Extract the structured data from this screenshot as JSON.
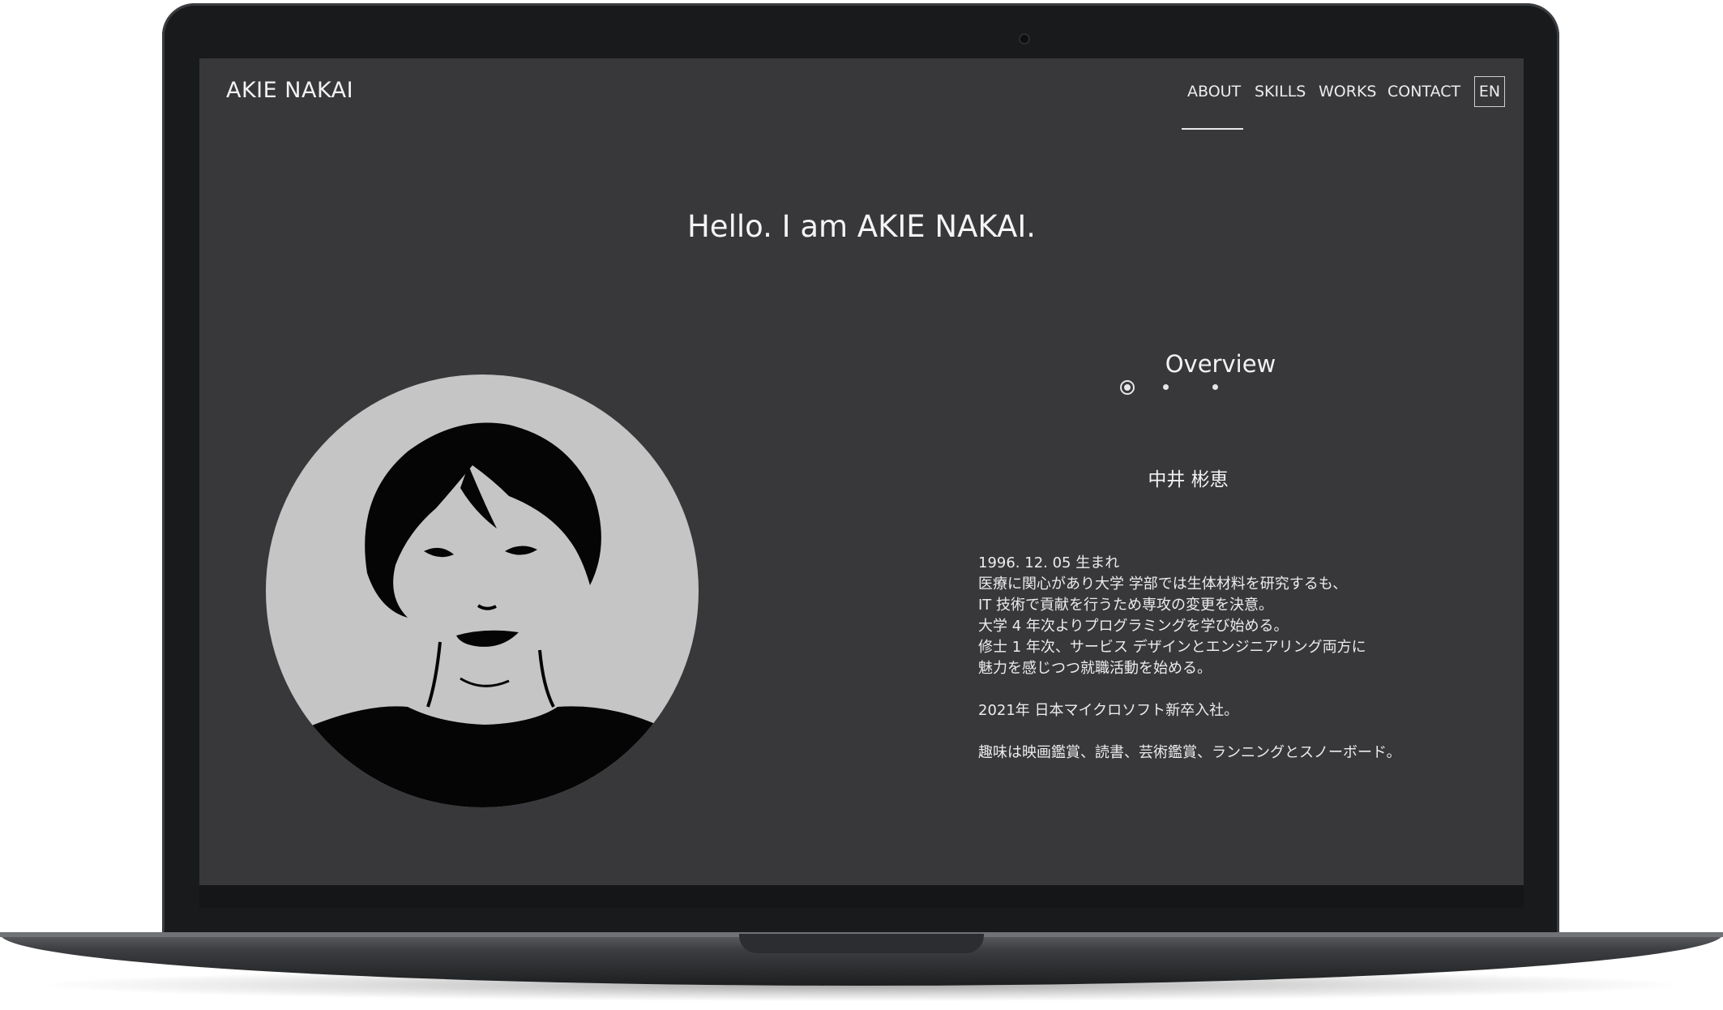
{
  "site": {
    "brand": "AKIE NAKAI",
    "nav": {
      "about": "ABOUT",
      "skills": "SKILLS",
      "works": "WORKS",
      "contact": "CONTACT",
      "lang": "EN",
      "active": "about"
    },
    "hero_title": "Hello. I am AKIE NAKAI.",
    "overview": {
      "title": "Overview",
      "dots": 3,
      "active_dot": 1
    },
    "name": "中井 彬恵",
    "bio": {
      "line1": "1996. 12. 05 生まれ",
      "line2": "医療に関心があり大学 学部では生体材料を研究するも、",
      "line3": "IT 技術で貢献を行うため専攻の変更を決意。",
      "line4": "大学 4 年次よりプログラミングを学び始める。",
      "line5": "修士 1 年次、サービス デザインとエンジニアリング両方に",
      "line6": "魅力を感じつつ就職活動を始める。",
      "line7": "2021年 日本マイクロソフト新卒入社。",
      "line8": "趣味は映画鑑賞、読書、芸術鑑賞、ランニングとスノーボード。"
    }
  },
  "colors": {
    "screen_bg": "#38383b",
    "text": "#f2f2f2",
    "avatar_bg": "#c5c5c5",
    "device_body": "#181a1c"
  }
}
